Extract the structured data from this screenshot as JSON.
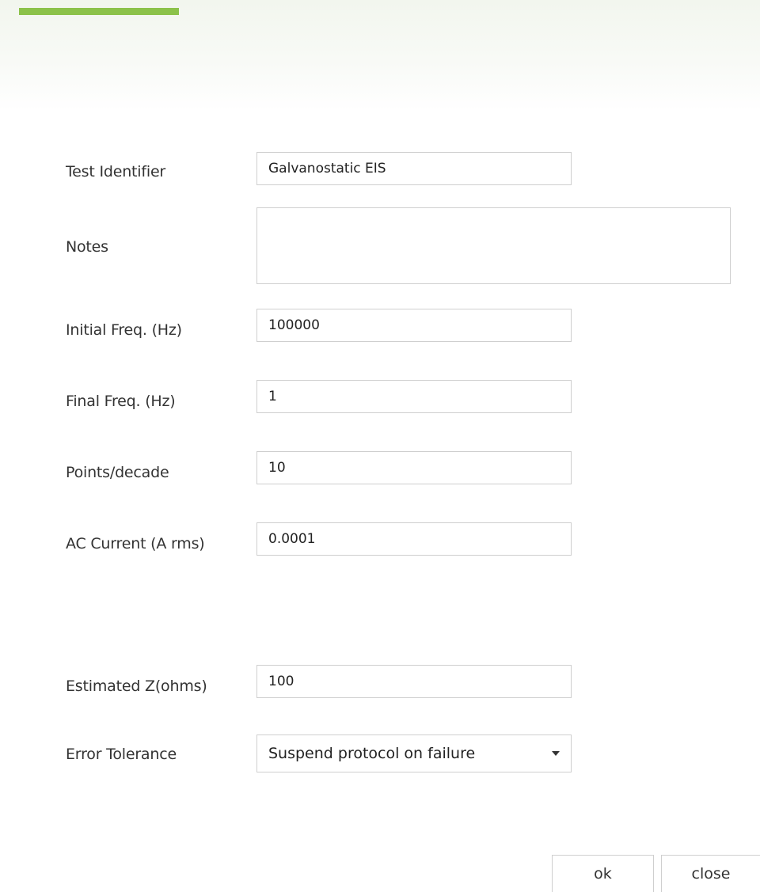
{
  "form": {
    "fields": [
      {
        "label": "Test Identifier",
        "value": "Galvanostatic EIS"
      },
      {
        "label": "Notes",
        "value": ""
      },
      {
        "label": "Initial Freq. (Hz)",
        "value": "100000"
      },
      {
        "label": "Final Freq. (Hz)",
        "value": "1"
      },
      {
        "label": "Points/decade",
        "value": "10"
      },
      {
        "label": "AC Current (A rms)",
        "value": "0.0001"
      },
      {
        "label": "Estimated Z(ohms)",
        "value": "100"
      },
      {
        "label": "Error Tolerance",
        "value": "Suspend protocol on failure"
      }
    ]
  },
  "buttons": {
    "ok_label": "ok",
    "close_label": "close"
  },
  "colors": {
    "accent": "#8cc24a",
    "header_tint": "#f2f6ee",
    "border": "#cfcfcf"
  },
  "icons": {
    "dropdown": "caret-down-icon"
  }
}
